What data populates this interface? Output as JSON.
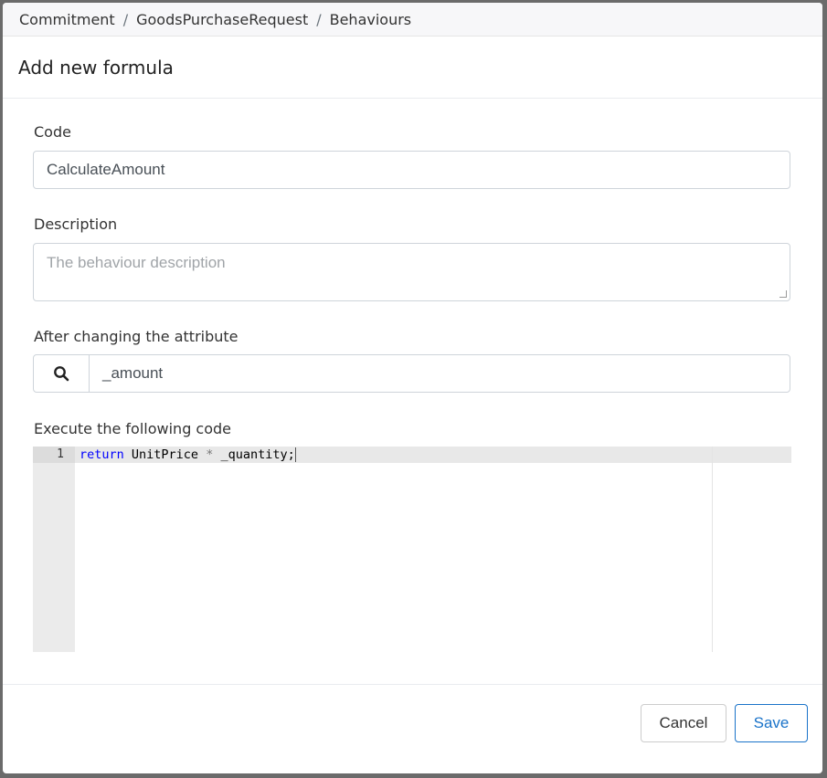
{
  "breadcrumb": [
    "Commitment",
    "GoodsPurchaseRequest",
    "Behaviours"
  ],
  "breadcrumb_separator": "/",
  "title": "Add new formula",
  "form": {
    "code_label": "Code",
    "code_value": "CalculateAmount",
    "description_label": "Description",
    "description_placeholder": "The behaviour description",
    "attribute_label": "After changing the attribute",
    "attribute_value": "_amount",
    "attribute_icon": "search-icon",
    "code_editor_label": "Execute the following code",
    "editor": {
      "line_number": "1",
      "keyword": "return",
      "rest_a": " UnitPrice ",
      "operator": "*",
      "rest_b": " _quantity;"
    }
  },
  "footer": {
    "cancel_label": "Cancel",
    "save_label": "Save"
  },
  "colors": {
    "primary": "#1a73c9",
    "keyword": "#0000ff"
  }
}
